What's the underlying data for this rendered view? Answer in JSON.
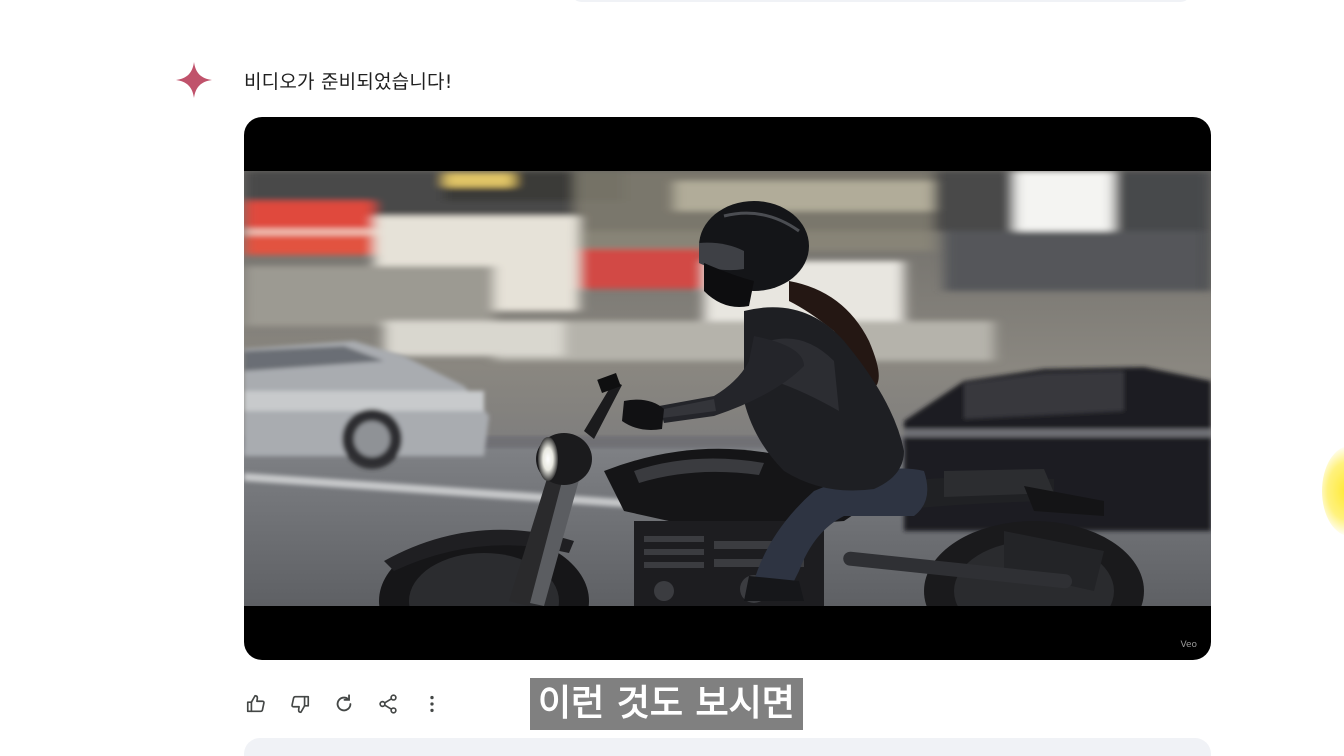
{
  "response": {
    "text": "비디오가 준비되었습니다!",
    "icon": "gemini-sparkle-icon",
    "accent_color": "#c0526b"
  },
  "video": {
    "watermark": "Veo",
    "subject": "woman in black helmet and leather jacket riding a motorcycle on a blurred city street"
  },
  "actions": {
    "items": [
      {
        "icon": "thumbs-up-icon"
      },
      {
        "icon": "thumbs-down-icon"
      },
      {
        "icon": "regenerate-icon"
      },
      {
        "icon": "share-icon"
      },
      {
        "icon": "more-vert-icon"
      }
    ]
  },
  "caption": {
    "text": "이런 것도 보시면"
  }
}
